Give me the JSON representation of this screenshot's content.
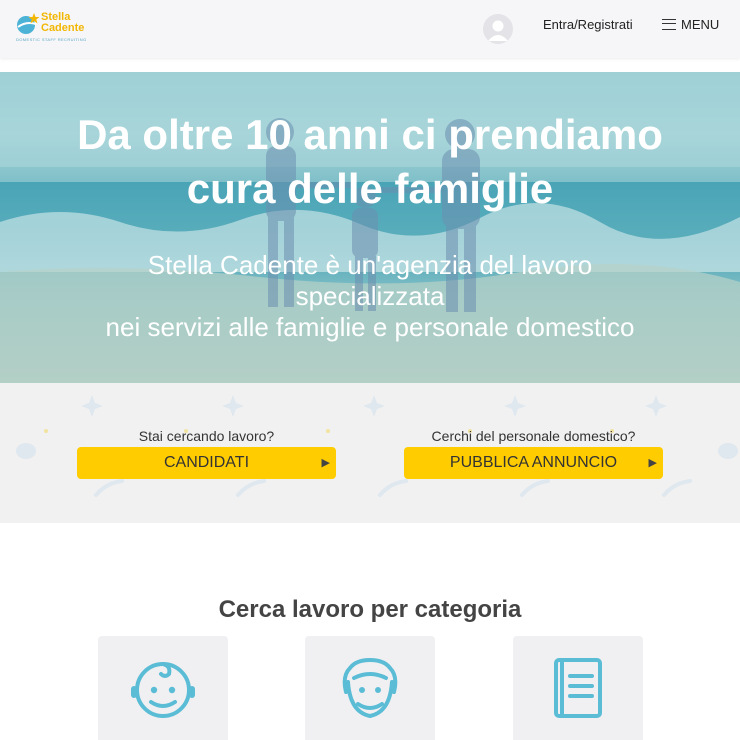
{
  "header": {
    "logo_line1": "Stella",
    "logo_line2": "Cadente",
    "logo_tagline": "DOMESTIC STAFF RECRUITING",
    "login_label": "Entra/Registrati",
    "menu_label": "MENU"
  },
  "hero": {
    "title_line1": "Da oltre 10 anni ci prendiamo",
    "title_line2": "cura delle famiglie",
    "subtitle_line1": "Stella Cadente è un'agenzia del lavoro",
    "subtitle_line2": "specializzata",
    "subtitle_line3": "nei servizi alle famiglie e personale domestico"
  },
  "cta": {
    "left_question": "Stai cercando lavoro?",
    "left_button": "CANDIDATI",
    "right_question": "Cerchi del personale domestico?",
    "right_button": "PUBBLICA ANNUNCIO"
  },
  "categories": {
    "title": "Cerca lavoro per categoria",
    "items": [
      {
        "icon": "baby-face-icon"
      },
      {
        "icon": "elderly-face-icon"
      },
      {
        "icon": "book-icon"
      }
    ]
  },
  "colors": {
    "accent_yellow": "#ffcc00",
    "icon_blue": "#5bbcd6",
    "logo_yellow": "#f2b705"
  }
}
